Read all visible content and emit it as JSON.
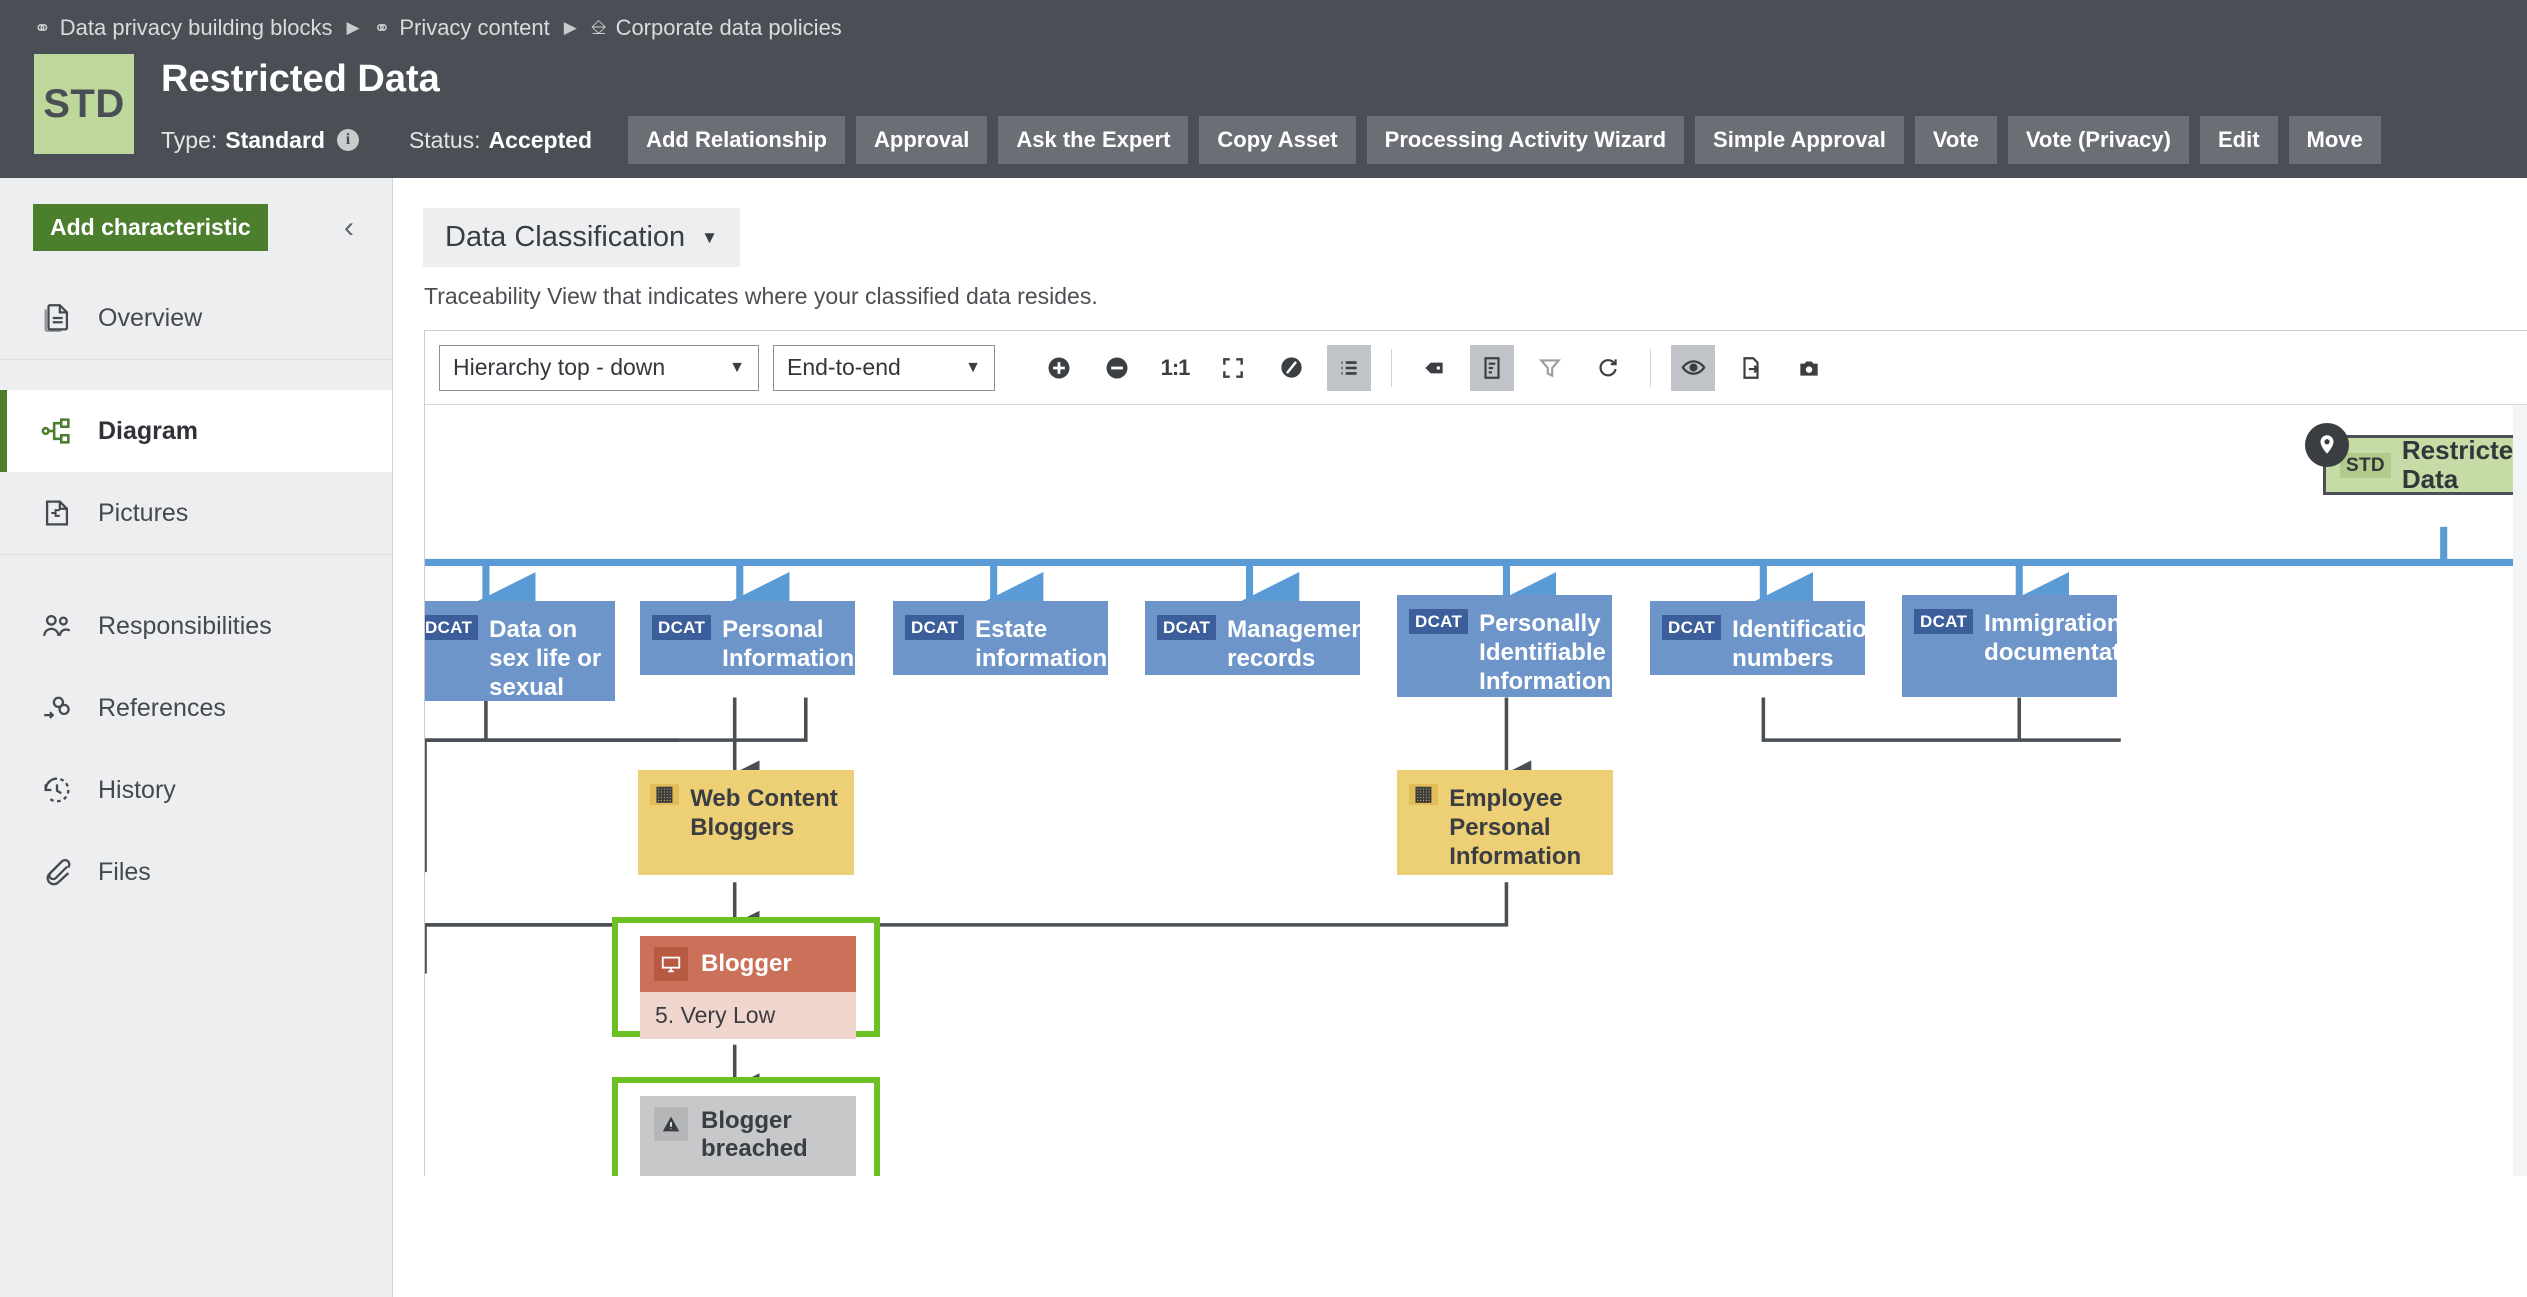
{
  "breadcrumb": {
    "items": [
      {
        "label": "Data privacy building blocks",
        "icon": "building-blocks-icon"
      },
      {
        "label": "Privacy content",
        "icon": "building-blocks-icon"
      },
      {
        "label": "Corporate data policies",
        "icon": "policy-icon"
      }
    ],
    "separator": "▶"
  },
  "header": {
    "badge": "STD",
    "title": "Restricted Data",
    "type_label": "Type:",
    "type_value": "Standard",
    "status_label": "Status:",
    "status_value": "Accepted",
    "info_glyph": "i",
    "actions": [
      "Add Relationship",
      "Approval",
      "Ask the Expert",
      "Copy Asset",
      "Processing Activity Wizard",
      "Simple Approval",
      "Vote",
      "Vote (Privacy)",
      "Edit",
      "Move"
    ]
  },
  "sidebar": {
    "add_characteristic": "Add characteristic",
    "collapse_glyph": "‹",
    "group1": [
      {
        "label": "Overview",
        "icon": "documents-icon",
        "active": false
      }
    ],
    "group2": [
      {
        "label": "Diagram",
        "icon": "diagram-icon",
        "active": true
      },
      {
        "label": "Pictures",
        "icon": "pictures-icon",
        "active": false
      }
    ],
    "group3": [
      {
        "label": "Responsibilities",
        "icon": "people-icon",
        "active": false
      },
      {
        "label": "References",
        "icon": "link-icon",
        "active": false
      },
      {
        "label": "History",
        "icon": "history-clock-icon",
        "active": false
      },
      {
        "label": "Files",
        "icon": "paperclip-icon",
        "active": false
      }
    ]
  },
  "main": {
    "view_selector": "Data Classification",
    "view_caret": "▼",
    "description": "Traceability View that indicates where your classified data resides."
  },
  "diagram_toolbar": {
    "layout_select": "Hierarchy top - down",
    "scope_select": "End-to-end",
    "caret": "▼",
    "ratio_label": "1:1",
    "icons": [
      {
        "name": "zoom-in-icon",
        "active": false
      },
      {
        "name": "zoom-out-icon",
        "active": false
      },
      {
        "name": "actual-size-icon",
        "active": false
      },
      {
        "name": "fit-to-screen-icon",
        "active": false
      },
      {
        "name": "contrast-icon",
        "active": false
      },
      {
        "name": "legend-list-icon",
        "active": true
      },
      {
        "name": "label-tag-icon",
        "active": false
      },
      {
        "name": "details-panel-icon",
        "active": true
      },
      {
        "name": "filter-icon",
        "active": false
      },
      {
        "name": "refresh-icon",
        "active": false
      },
      {
        "name": "show-hide-eye-icon",
        "active": true
      },
      {
        "name": "export-icon",
        "active": false
      },
      {
        "name": "snapshot-camera-icon",
        "active": false
      }
    ]
  },
  "diagram": {
    "root_node": {
      "tag": "STD",
      "label": "Restricted Data",
      "pin": "location-pin-icon"
    },
    "dcat_nodes": [
      {
        "tag": "DCAT",
        "label": "Data on sex life or sexual orientation"
      },
      {
        "tag": "DCAT",
        "label": "Personal Information"
      },
      {
        "tag": "DCAT",
        "label": "Estate information"
      },
      {
        "tag": "DCAT",
        "label": "Management records"
      },
      {
        "tag": "DCAT",
        "label": "Personally Identifiable Information"
      },
      {
        "tag": "DCAT",
        "label": "Identification numbers"
      },
      {
        "tag": "DCAT",
        "label": "Immigration documentation"
      }
    ],
    "amber_nodes": [
      {
        "icon": "table-columns-icon",
        "label": "Web Content Bloggers"
      },
      {
        "icon": "table-columns-icon",
        "label": "Employee Personal Information"
      }
    ],
    "selected_cards": [
      {
        "icon": "monitor-icon",
        "title": "Blogger",
        "subtitle": "5. Very Low",
        "style": "red"
      },
      {
        "icon": "warning-triangle-icon",
        "title": "Blogger breached",
        "subtitle": "",
        "style": "grey"
      }
    ]
  },
  "colors": {
    "topbar": "#4a4f55",
    "accent_green": "#4b7f2d",
    "badge_green": "#bed79b",
    "dcat_blue": "#6d95c9",
    "dcat_tag_blue": "#3c5f9c",
    "link_blue": "#5b9bd5",
    "amber": "#edcf76",
    "selection_green": "#6cc024",
    "card_red": "#cc7159",
    "card_grey": "#c6c8ca"
  }
}
